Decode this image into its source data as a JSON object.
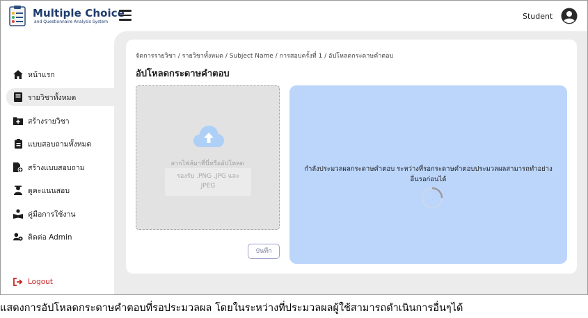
{
  "app": {
    "title": "Multiple Choice",
    "subtitle": "and Questionnaire Analysis System"
  },
  "header": {
    "user_label": "Student"
  },
  "sidebar": {
    "items": [
      {
        "label": "หน้าแรก",
        "icon": "home-icon"
      },
      {
        "label": "รายวิชาทั้งหมด",
        "icon": "book-icon",
        "active": true
      },
      {
        "label": "สร้างรายวิชา",
        "icon": "add-folder-icon"
      },
      {
        "label": "แบบสอบถามทั้งหมด",
        "icon": "clipboard-icon"
      },
      {
        "label": "สร้างแบบสอบถาม",
        "icon": "create-survey-icon"
      },
      {
        "label": "ดูคะแนนสอบ",
        "icon": "score-icon"
      },
      {
        "label": "คู่มือการใช้งาน",
        "icon": "manual-icon"
      },
      {
        "label": "ติดต่อ Admin",
        "icon": "contact-admin-icon"
      }
    ],
    "logout_label": "Logout"
  },
  "main": {
    "breadcrumb": "จัดการรายวิชา / รายวิชาทั้งหมด / Subject Name / การสอบครั้งที่ 1 / อัปโหลดกระดาษคำตอบ",
    "title": "อัปโหลดกระดาษคำตอบ",
    "dropzone": {
      "text": "ลากไฟล์มาที่นี่หรืออัปโหลด",
      "formats_line1": "รองรับ .PNG .JPG และ",
      "formats_line2": "JPEG"
    },
    "save_label": "บันทึก",
    "status": {
      "line1": "กำลังประมวลผลกระดาษคำตอบ ระหว่างที่รอกระดาษคำตอบประมวลผลสามารถทำอย่าง",
      "line2": "อื่นรอก่อนได้"
    }
  },
  "caption": "แสดงการอัปโหลดกระดาษคำตอบที่รอประมวลผล โดยในระหว่างที่ประมวลผลผู้ใช้สามารถดำเนินการอื่นๆได้",
  "colors": {
    "brand": "#1f3c6e",
    "status_panel": "#bcd6fb",
    "logout": "#cc2222",
    "content_bg": "#ececec"
  }
}
